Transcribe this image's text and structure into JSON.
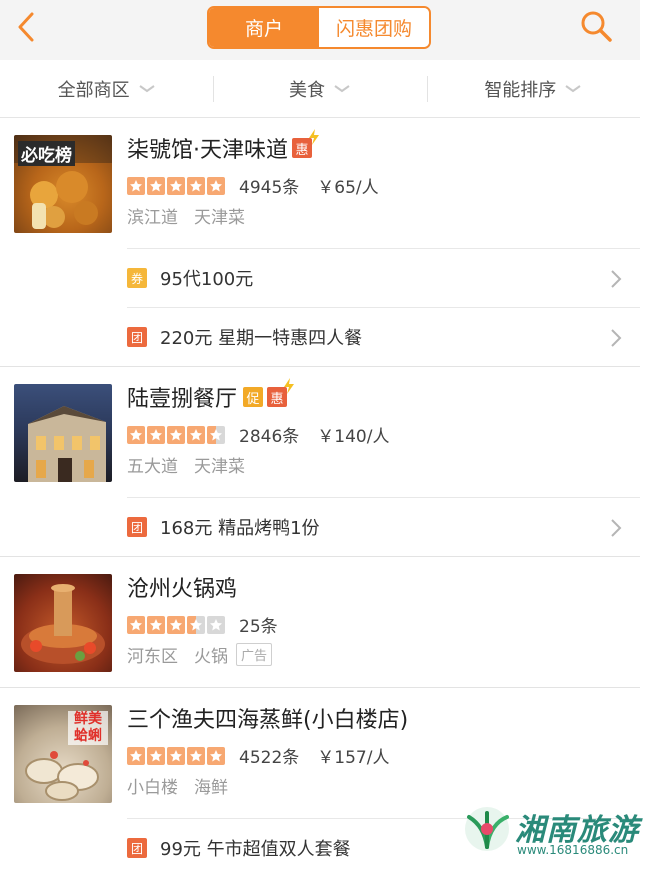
{
  "header": {
    "tabs": [
      {
        "label": "商户",
        "active": true
      },
      {
        "label": "闪惠团购",
        "active": false
      }
    ],
    "accent_color": "#f5892e"
  },
  "filters": [
    {
      "label": "全部商区"
    },
    {
      "label": "美食"
    },
    {
      "label": "智能排序"
    }
  ],
  "shops": [
    {
      "name": "柒號馆·天津味道",
      "badges": [
        "惠"
      ],
      "rating_stars": 5,
      "reviews": "4945条",
      "price": "￥65/人",
      "area": "滨江道",
      "cuisine": "天津菜",
      "thumb_text": "必吃榜",
      "deals": [
        {
          "type": "券",
          "text": "95代100元"
        },
        {
          "type": "团",
          "text": "220元 星期一特惠四人餐"
        }
      ]
    },
    {
      "name": "陆壹捌餐厅",
      "badges": [
        "促",
        "惠"
      ],
      "rating_stars": 4.5,
      "reviews": "2846条",
      "price": "￥140/人",
      "area": "五大道",
      "cuisine": "天津菜",
      "deals": [
        {
          "type": "团",
          "text": "168元 精品烤鸭1份"
        }
      ]
    },
    {
      "name": "沧州火锅鸡",
      "badges": [],
      "rating_stars": 3.5,
      "reviews": "25条",
      "price": "",
      "area": "河东区",
      "cuisine": "火锅",
      "ad_label": "广告",
      "deals": []
    },
    {
      "name": "三个渔夫四海蒸鲜(小白楼店)",
      "badges": [],
      "rating_stars": 5,
      "reviews": "4522条",
      "price": "￥157/人",
      "area": "小白楼",
      "cuisine": "海鲜",
      "thumb_text": "鲜美蛤蜊",
      "deals": [
        {
          "type": "团",
          "text": "99元 午市超值双人套餐"
        }
      ]
    }
  ],
  "watermark": {
    "title": "湘南旅游",
    "url": "www.16816886.cn"
  }
}
